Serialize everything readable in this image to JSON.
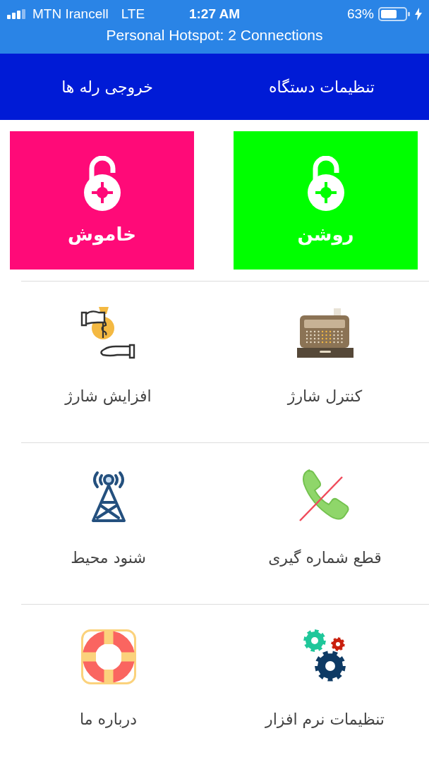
{
  "status_bar": {
    "carrier": "MTN Irancell",
    "network": "LTE",
    "time": "1:27 AM",
    "battery": "63%",
    "hotspot": "Personal Hotspot: 2 Connections"
  },
  "tabs": [
    {
      "label": "تنظیمات دستگاه"
    },
    {
      "label": "خروجی رله ها"
    }
  ],
  "switches": [
    {
      "label": "روشن",
      "color": "#00ff00"
    },
    {
      "label": "خاموش",
      "color": "#ff0a78"
    }
  ],
  "menu": [
    {
      "label": "کنترل شارژ",
      "kind": "register"
    },
    {
      "label": "افزایش شارژ",
      "kind": "money"
    },
    {
      "label": "قطع شماره گیری",
      "kind": "phone-off"
    },
    {
      "label": "شنود محیط",
      "kind": "tower"
    },
    {
      "label": "تنظیمات نرم افزار",
      "kind": "gears"
    },
    {
      "label": "درباره ما",
      "kind": "lifebuoy"
    }
  ]
}
